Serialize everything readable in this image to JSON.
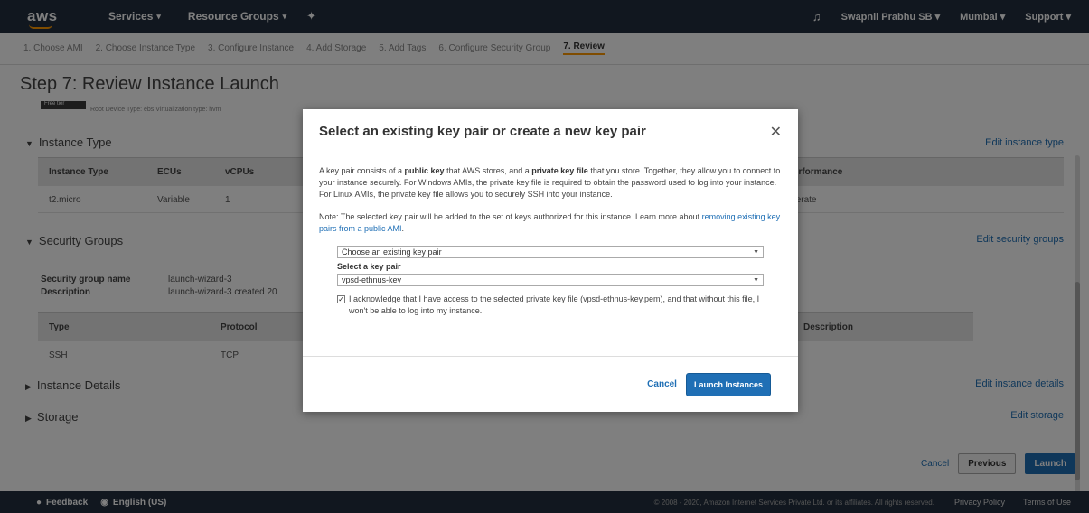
{
  "topnav": {
    "logo": "aws",
    "services": "Services",
    "resource_groups": "Resource Groups",
    "account": "Swapnil Prabhu SB",
    "region": "Mumbai",
    "support": "Support"
  },
  "steps": [
    "1. Choose AMI",
    "2. Choose Instance Type",
    "3. Configure Instance",
    "4. Add Storage",
    "5. Add Tags",
    "6. Configure Security Group",
    "7. Review"
  ],
  "page": {
    "title": "Step 7: Review Instance Launch",
    "free_badge": "Free tier",
    "sub_note": "Root Device Type: ebs    Virtualization type: hvm",
    "instance_type_section": "Instance Type",
    "edit_instance_type": "Edit instance type",
    "instance_headers": [
      "Instance Type",
      "ECUs",
      "vCPUs",
      "Network Performance"
    ],
    "instance_row": [
      "t2.micro",
      "Variable",
      "1",
      "Low to Moderate"
    ],
    "security_section": "Security Groups",
    "edit_security": "Edit security groups",
    "sg_name_label": "Security group name",
    "sg_name_value": "launch-wizard-3",
    "sg_desc_label": "Description",
    "sg_desc_value": "launch-wizard-3 created 20",
    "sg_headers": [
      "Type",
      "Protocol",
      "Description"
    ],
    "sg_row": [
      "SSH",
      "TCP"
    ],
    "instance_details_section": "Instance Details",
    "edit_details": "Edit instance details",
    "storage_section": "Storage",
    "edit_storage": "Edit storage",
    "cancel": "Cancel",
    "previous": "Previous",
    "launch": "Launch"
  },
  "footer": {
    "feedback": "Feedback",
    "language": "English (US)",
    "copyright": "© 2008 - 2020, Amazon Internet Services Private Ltd. or its affiliates. All rights reserved.",
    "privacy": "Privacy Policy",
    "terms": "Terms of Use"
  },
  "modal": {
    "title": "Select an existing key pair or create a new key pair",
    "intro_1": "A key pair consists of a ",
    "intro_public": "public key",
    "intro_2": " that AWS stores, and a ",
    "intro_private": "private key file",
    "intro_3": " that you store. Together, they allow you to connect to your instance securely. For Windows AMIs, the private key file is required to obtain the password used to log into your instance. For Linux AMIs, the private key file allows you to securely SSH into your instance.",
    "note": "Note: The selected key pair will be added to the set of keys authorized for this instance. Learn more about ",
    "note_link": "removing existing key pairs from a public AMI",
    "note_end": ".",
    "mode_select": "Choose an existing key pair",
    "key_label": "Select a key pair",
    "key_select": "vpsd-ethnus-key",
    "ack": "I acknowledge that I have access to the selected private key file (vpsd-ethnus-key.pem), and that without this file, I won't be able to log into my instance.",
    "cancel": "Cancel",
    "launch": "Launch Instances"
  }
}
